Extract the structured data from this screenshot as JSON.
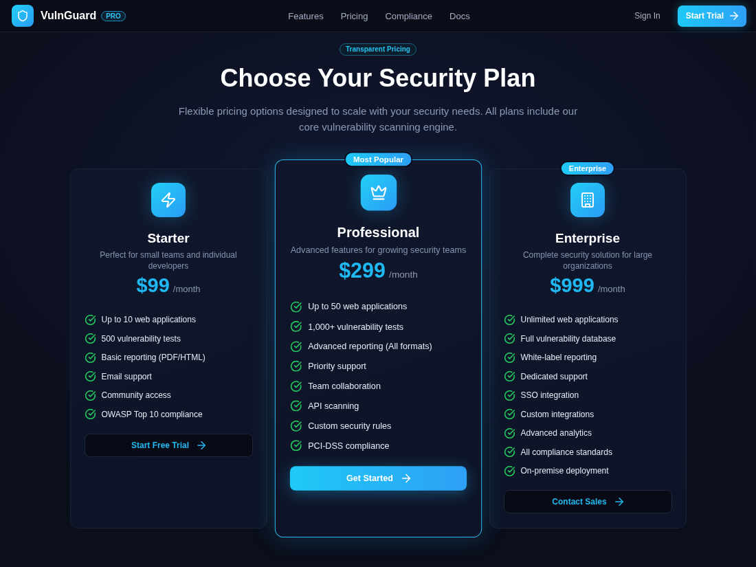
{
  "header": {
    "brand": "VulnGuard",
    "brand_tag": "PRO",
    "nav": [
      "Features",
      "Pricing",
      "Compliance",
      "Docs"
    ],
    "sign_in": "Sign In",
    "cta": "Start Trial"
  },
  "hero": {
    "eyebrow": "Transparent Pricing",
    "title": "Choose Your Security Plan",
    "subtitle": "Flexible pricing options designed to scale with your security needs. All plans include our core vulnerability scanning engine."
  },
  "plans": [
    {
      "name": "Starter",
      "description": "Perfect for small teams and individual developers",
      "price": "$99",
      "period": "/month",
      "highlighted": false,
      "features": [
        "Up to 10 web applications",
        "500 vulnerability tests",
        "Basic reporting (PDF/HTML)",
        "Email support",
        "Community access",
        "OWASP Top 10 compliance"
      ],
      "button": "Start Free Trial"
    },
    {
      "name": "Professional",
      "badge": "Most Popular",
      "description": "Advanced features for growing security teams",
      "price": "$299",
      "period": "/month",
      "highlighted": true,
      "features": [
        "Up to 50 web applications",
        "1,000+ vulnerability tests",
        "Advanced reporting (All formats)",
        "Priority support",
        "Team collaboration",
        "API scanning",
        "Custom security rules",
        "PCI-DSS compliance"
      ],
      "button": "Get Started"
    },
    {
      "name": "Enterprise",
      "badge": "Enterprise",
      "description": "Complete security solution for large organizations",
      "price": "$999",
      "period": "/month",
      "highlighted": false,
      "features": [
        "Unlimited web applications",
        "Full vulnerability database",
        "White-label reporting",
        "Dedicated support",
        "SSO integration",
        "Custom integrations",
        "Advanced analytics",
        "All compliance standards",
        "On-premise deployment"
      ],
      "button": "Contact Sales"
    }
  ]
}
